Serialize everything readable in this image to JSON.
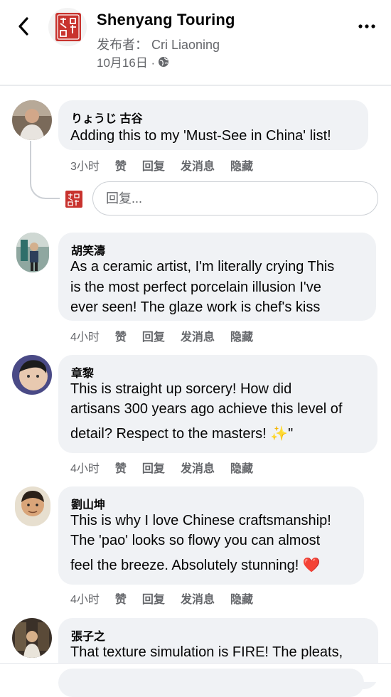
{
  "header": {
    "title": "Shenyang Touring",
    "publisher": "发布者： Cri Liaoning",
    "date": "10月16日 ·",
    "seal_colors": {
      "red": "#c8332e"
    }
  },
  "reply_input": {
    "placeholder": "回复..."
  },
  "comments": [
    {
      "name": "りょうじ 古谷",
      "lines": [
        "Adding this to my 'Must-See in China' list!"
      ],
      "time": "3小时",
      "actions": [
        "赞",
        "回复",
        "发消息",
        "隐藏"
      ]
    },
    {
      "name": "胡笑濤",
      "lines": [
        "As a ceramic artist, I'm literally crying  This",
        "is the most perfect porcelain illusion I've",
        "ever seen! The glaze work is chef's kiss"
      ],
      "time": "4小时",
      "actions": [
        "赞",
        "回复",
        "发消息",
        "隐藏"
      ]
    },
    {
      "name": "章黎",
      "lines": [
        "This is straight up sorcery!  How did",
        "artisans 300 years ago achieve this level of",
        "detail? Respect to the masters! ✨\""
      ],
      "time": "4小时",
      "actions": [
        "赞",
        "回复",
        "发消息",
        "隐藏"
      ]
    },
    {
      "name": "劉山坤",
      "lines": [
        "This is why I love Chinese craftsmanship!",
        "The 'pao' looks so flowy you can almost",
        "feel the breeze. Absolutely stunning! ❤️"
      ],
      "time": "4小时",
      "actions": [
        "赞",
        "回复",
        "发消息",
        "隐藏"
      ]
    },
    {
      "name": "張子之",
      "lines": [
        "That texture simulation is FIRE!  The pleats,"
      ]
    }
  ]
}
